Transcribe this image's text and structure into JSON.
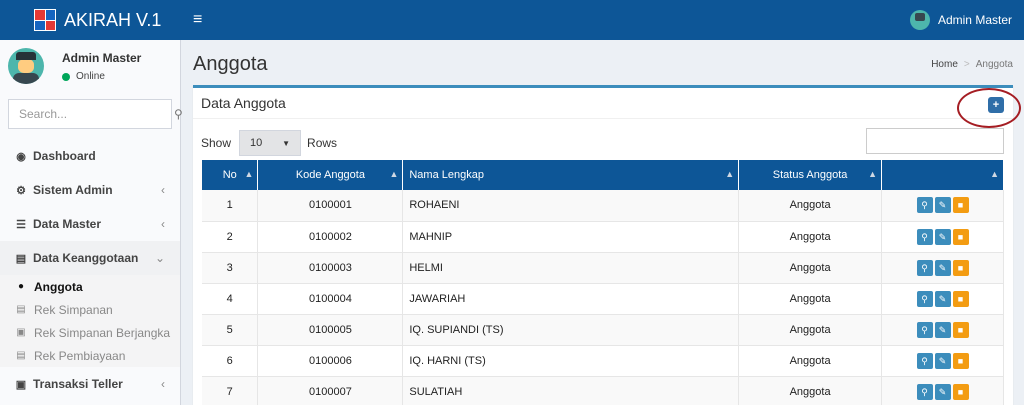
{
  "header": {
    "brand": "AKIRAH V.1",
    "menu_toggle": "≡",
    "user_name": "Admin Master"
  },
  "sidebar": {
    "user_name": "Admin Master",
    "user_status": "Online",
    "search_placeholder": "Search...",
    "menu": [
      {
        "label": "Dashboard",
        "icon": "dashboard-icon"
      },
      {
        "label": "Sistem Admin",
        "icon": "gear-icon"
      },
      {
        "label": "Data Master",
        "icon": "database-icon"
      },
      {
        "label": "Data Keanggotaan",
        "icon": "id-card-icon"
      },
      {
        "label": "Transaksi Teller",
        "icon": "briefcase-icon"
      }
    ],
    "submenu": [
      {
        "label": "Anggota",
        "icon": "user-icon",
        "active": true
      },
      {
        "label": "Rek Simpanan",
        "icon": "id-card-icon"
      },
      {
        "label": "Rek Simpanan Berjangka",
        "icon": "hdd-icon"
      },
      {
        "label": "Rek Pembiayaan",
        "icon": "id-card-icon"
      }
    ]
  },
  "page": {
    "title": "Anggota",
    "breadcrumb_home": "Home",
    "breadcrumb_current": "Anggota"
  },
  "box": {
    "title": "Data Anggota",
    "add_label": "+"
  },
  "table_controls": {
    "show_label": "Show",
    "rows_value": "10",
    "rows_label": "Rows"
  },
  "table": {
    "columns": [
      "No",
      "Kode Anggota",
      "Nama Lengkap",
      "Status Anggota",
      ""
    ],
    "rows": [
      {
        "no": "1",
        "kode": "0100001",
        "nama": "ROHAENI",
        "status": "Anggota"
      },
      {
        "no": "2",
        "kode": "0100002",
        "nama": "MAHNIP",
        "status": "Anggota"
      },
      {
        "no": "3",
        "kode": "0100003",
        "nama": "HELMI",
        "status": "Anggota"
      },
      {
        "no": "4",
        "kode": "0100004",
        "nama": "JAWARIAH",
        "status": "Anggota"
      },
      {
        "no": "5",
        "kode": "0100005",
        "nama": "IQ. SUPIANDI (TS)",
        "status": "Anggota"
      },
      {
        "no": "6",
        "kode": "0100006",
        "nama": "IQ. HARNI (TS)",
        "status": "Anggota"
      },
      {
        "no": "7",
        "kode": "0100007",
        "nama": "SULATIAH",
        "status": "Anggota"
      }
    ]
  },
  "colors": {
    "header_bg": "#0d5697",
    "accent": "#3c8dbc",
    "warning": "#f39c12",
    "highlight_ring": "#a51d23"
  }
}
